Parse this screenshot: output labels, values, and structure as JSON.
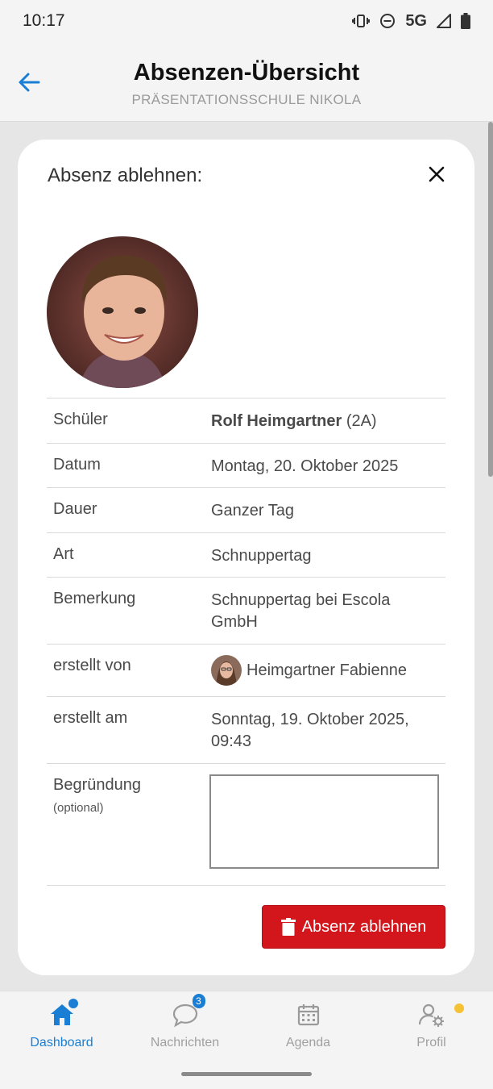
{
  "status": {
    "time": "10:17",
    "network": "5G"
  },
  "header": {
    "title": "Absenzen-Übersicht",
    "subtitle": "PRÄSENTATIONSSCHULE NIKOLA"
  },
  "modal": {
    "title": "Absenz ablehnen:",
    "rows": {
      "student": {
        "label": "Schüler",
        "name": "Rolf Heimgartner",
        "class": "(2A)"
      },
      "date": {
        "label": "Datum",
        "value": "Montag, 20. Oktober 2025"
      },
      "duration": {
        "label": "Dauer",
        "value": "Ganzer Tag"
      },
      "type": {
        "label": "Art",
        "value": "Schnuppertag"
      },
      "remark": {
        "label": "Bemerkung",
        "value": "Schnuppertag bei Escola GmbH"
      },
      "created_by": {
        "label": "erstellt von",
        "value": "Heimgartner Fabienne"
      },
      "created_at": {
        "label": "erstellt am",
        "value": "Sonntag, 19. Oktober 2025, 09:43"
      },
      "reason": {
        "label": "Begründung",
        "hint": "(optional)",
        "value": ""
      }
    },
    "reject_button": "Absenz ablehnen"
  },
  "nav": {
    "dashboard": "Dashboard",
    "messages": "Nachrichten",
    "messages_badge": "3",
    "agenda": "Agenda",
    "profile": "Profil"
  },
  "colors": {
    "accent": "#1a7fd4",
    "danger": "#d2161c",
    "notice": "#f4c234"
  }
}
